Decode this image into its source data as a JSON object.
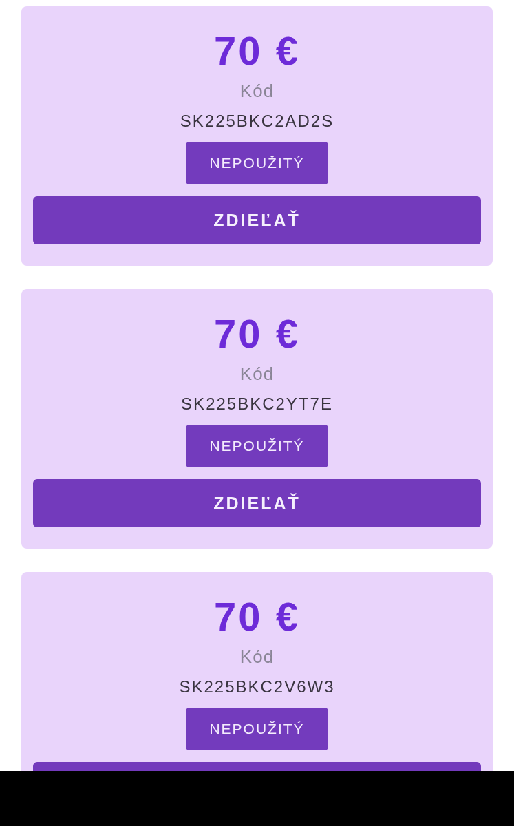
{
  "vouchers": [
    {
      "price": "70 €",
      "code_label": "Kód",
      "code": "SK225BKC2AD2S",
      "status": "NEPOUŽITÝ",
      "share_button": {
        "label": "ZDIEĽAŤ",
        "cut_off": false
      }
    },
    {
      "price": "70 €",
      "code_label": "Kód",
      "code": "SK225BKC2YT7E",
      "status": "NEPOUŽITÝ",
      "share_button": {
        "label": "ZDIEĽAŤ",
        "cut_off": false
      }
    },
    {
      "price": "70 €",
      "code_label": "Kód",
      "code": "SK225BKC2V6W3",
      "status": "NEPOUŽITÝ",
      "share_button": {
        "cut_off": true
      }
    }
  ]
}
